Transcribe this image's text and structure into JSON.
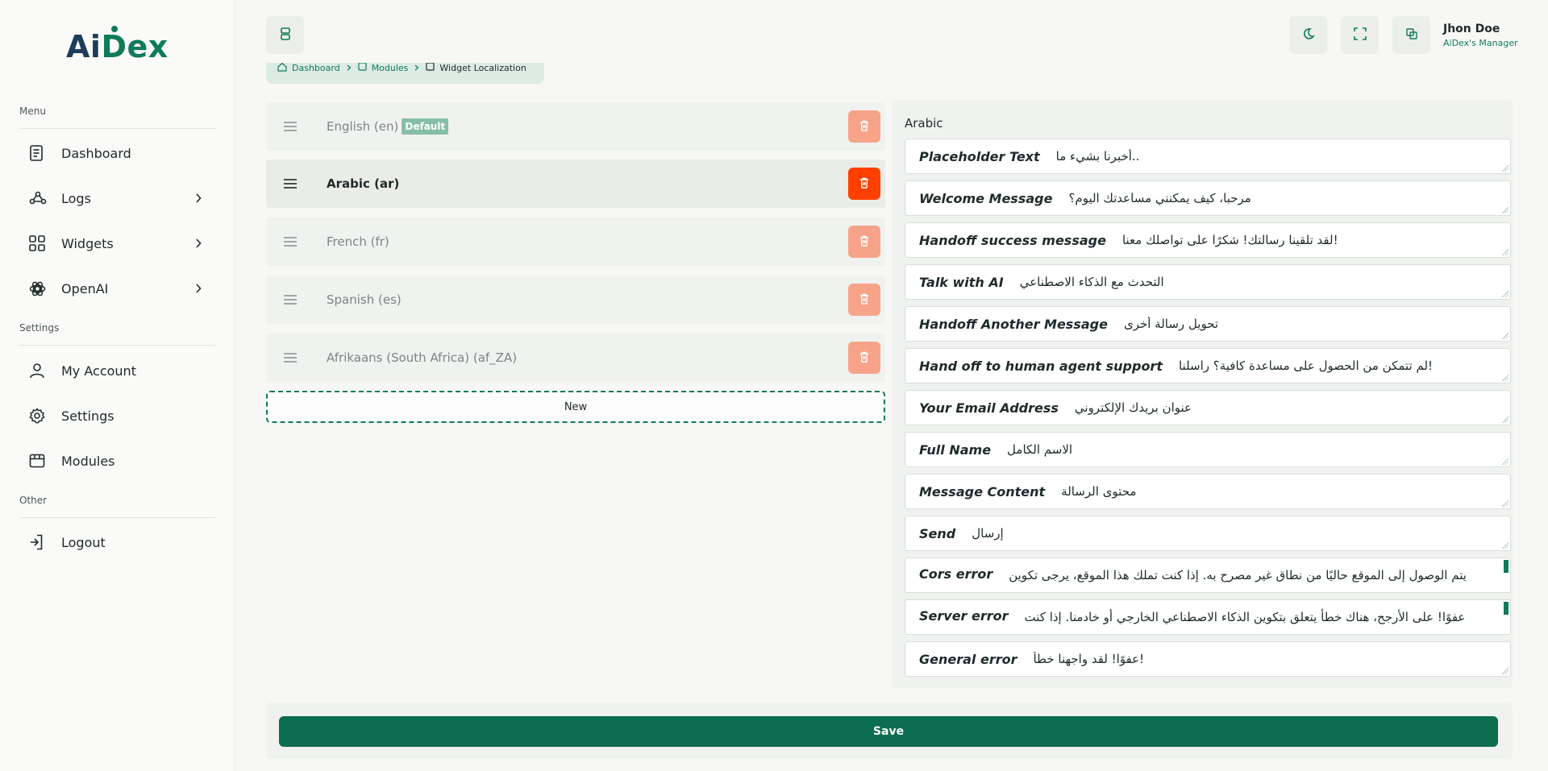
{
  "brand": {
    "part1": "Ai",
    "part2": "Dex"
  },
  "sidebar": {
    "menu_title": "Menu",
    "settings_title": "Settings",
    "other_title": "Other",
    "items": [
      {
        "label": "Dashboard",
        "icon": "file-text-icon"
      },
      {
        "label": "Logs",
        "icon": "share-graph-icon",
        "has_children": true
      },
      {
        "label": "Widgets",
        "icon": "grid-icon",
        "has_children": true
      },
      {
        "label": "OpenAI",
        "icon": "openai-icon",
        "has_children": true
      },
      {
        "label": "My Account",
        "icon": "user-icon"
      },
      {
        "label": "Settings",
        "icon": "gear-icon"
      },
      {
        "label": "Modules",
        "icon": "box-icon"
      },
      {
        "label": "Logout",
        "icon": "logout-icon"
      }
    ]
  },
  "topbar": {
    "user_name": "Jhon Doe",
    "user_role": "AiDex's Manager"
  },
  "breadcrumb": {
    "items": [
      "Dashboard",
      "Modules",
      "Widget Localization"
    ]
  },
  "languages": {
    "items": [
      {
        "label": "English (en)",
        "badge": "Default"
      },
      {
        "label": "Arabic (ar)"
      },
      {
        "label": "French (fr)"
      },
      {
        "label": "Spanish (es)"
      },
      {
        "label": "Afrikaans (South Africa) (af_ZA)"
      }
    ],
    "active_index": 1,
    "new_label": "New"
  },
  "panel": {
    "title": "Arabic",
    "fields": [
      {
        "label": "Placeholder Text",
        "value": "..أخبرنا بشيء ما"
      },
      {
        "label": "Welcome Message",
        "value": "مرحبا، كيف يمكنني مساعدتك اليوم؟"
      },
      {
        "label": "Handoff success message",
        "value": "!لقد تلقينا رسالتك! شكرًا على تواصلك معنا"
      },
      {
        "label": "Talk with AI",
        "value": "التحدث مع الذكاء الاصطناعي"
      },
      {
        "label": "Handoff Another Message",
        "value": "تحويل رسالة أخرى"
      },
      {
        "label": "Hand off to human agent support",
        "value": "!لم تتمكن من الحصول على مساعدة كافية؟ راسلنا"
      },
      {
        "label": "Your Email Address",
        "value": "عنوان بريدك الإلكتروني"
      },
      {
        "label": "Full Name",
        "value": "الاسم الكامل"
      },
      {
        "label": "Message Content",
        "value": "محتوى الرسالة"
      },
      {
        "label": "Send",
        "value": "إرسال"
      },
      {
        "label": "Cors error",
        "value": "يتم الوصول إلى الموقع حاليًا من نطاق غير مصرح به. إذا كنت تملك هذا الموقع، يرجى تكوين"
      },
      {
        "label": "Server error",
        "value": "عفوًا! على الأرجح، هناك خطأ يتعلق بتكوين الذكاء الاصطناعي الخارجي أو خادمنا. إذا كنت"
      },
      {
        "label": "General error",
        "value": "!عفوًا! لقد واجهنا خطأ"
      }
    ]
  },
  "save_label": "Save",
  "colors": {
    "primary": "#117a5b",
    "save": "#0d6d4f",
    "danger_active": "#ff4000",
    "danger": "#f7a38a",
    "badge": "#86bfa8"
  }
}
